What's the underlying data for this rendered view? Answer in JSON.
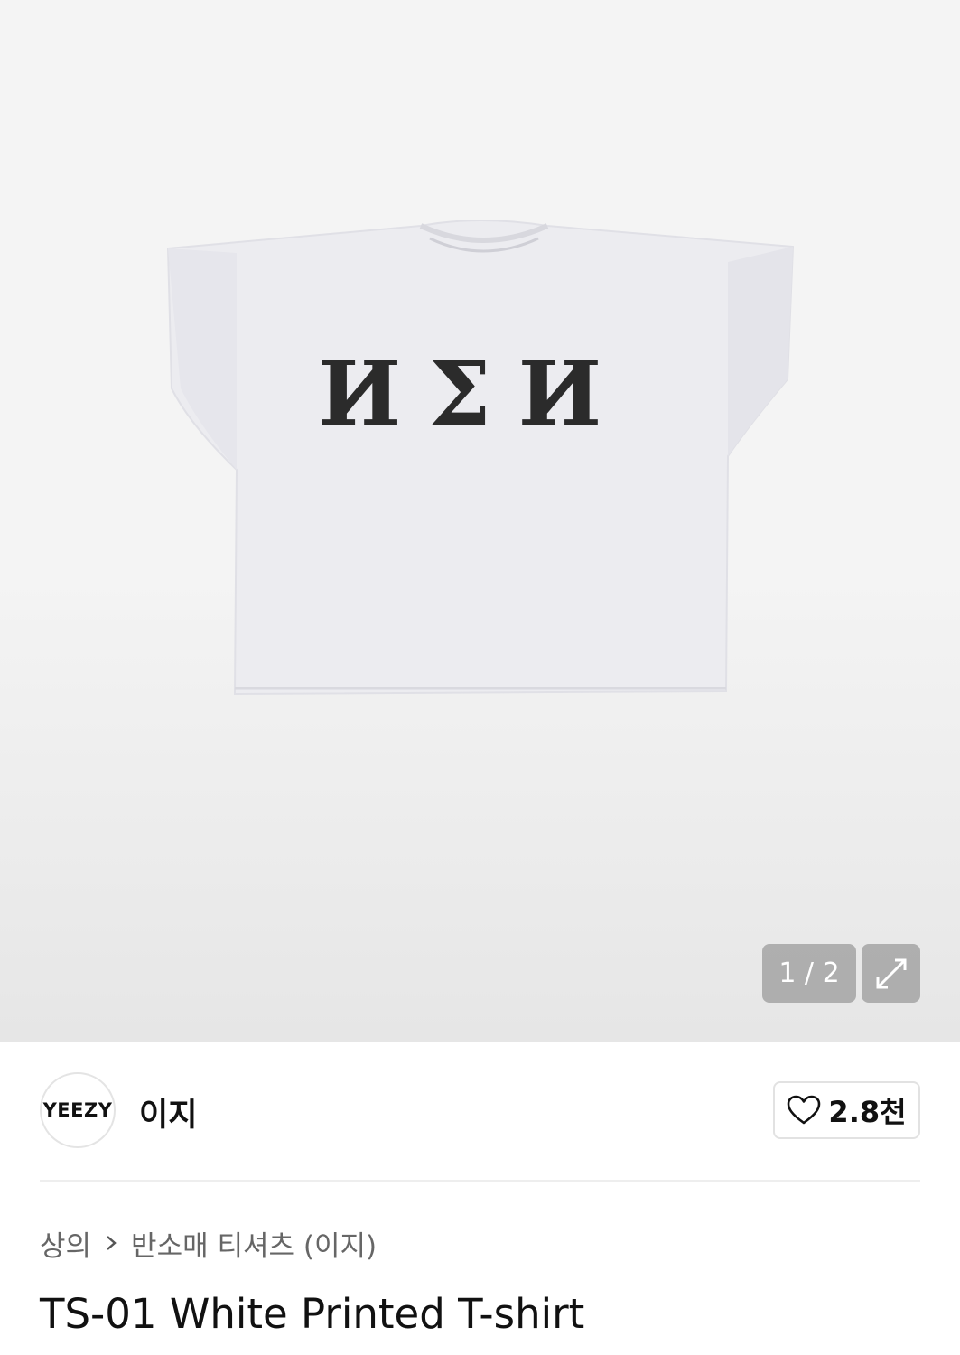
{
  "gallery": {
    "counter": "1 / 2",
    "image_print": "ИΣИ",
    "expand_icon": "expand-arrows-icon"
  },
  "brand": {
    "logo_text": "YEEZY",
    "name": "이지"
  },
  "like": {
    "icon": "heart-icon",
    "count": "2.8천"
  },
  "breadcrumb": {
    "category": "상의",
    "subcategory": "반소매 티셔츠 (이지)"
  },
  "product": {
    "title": "TS-01 White Printed T-shirt"
  },
  "colors": {
    "overlay": "#969696",
    "text_primary": "#111111",
    "text_secondary": "#666666",
    "divider": "#eeeeee"
  }
}
